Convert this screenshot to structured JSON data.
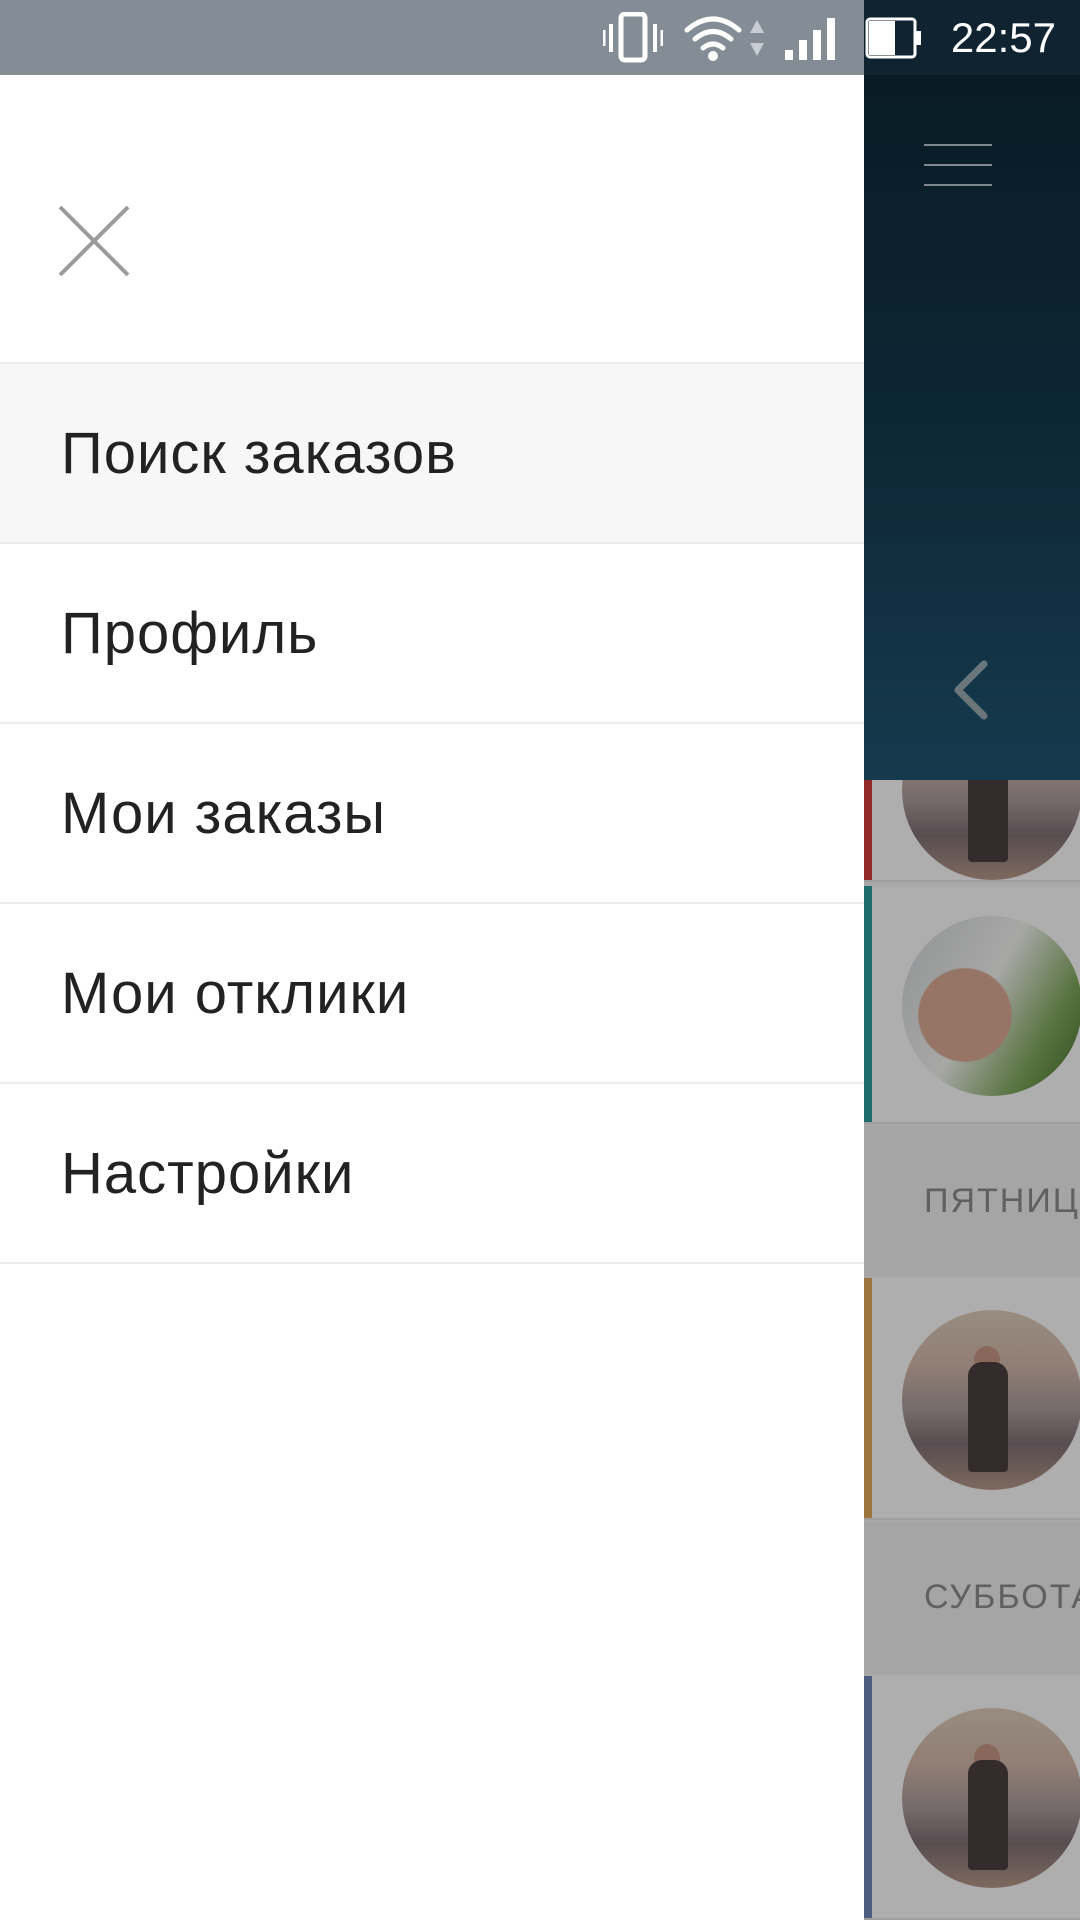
{
  "status_bar": {
    "time": "22:57",
    "icons": [
      "vibrate-icon",
      "wifi-icon",
      "data-arrows-icon",
      "signal-icon",
      "battery-icon"
    ]
  },
  "drawer": {
    "close_icon": "close-icon",
    "items": [
      {
        "label": "Поиск заказов",
        "active": true
      },
      {
        "label": "Профиль",
        "active": false
      },
      {
        "label": "Мои заказы",
        "active": false
      },
      {
        "label": "Мои отклики",
        "active": false
      },
      {
        "label": "Настройки",
        "active": false
      }
    ]
  },
  "background": {
    "header_icons": [
      "menu-icon",
      "back-chevron-icon"
    ],
    "sections": [
      {
        "label": "ПЯТНИЦА"
      },
      {
        "label": "СУББОТА"
      }
    ],
    "card_strip_colors": [
      "#d23b3b",
      "#2a9a9a",
      "#e0a65a",
      "#6f86b8"
    ]
  },
  "colors": {
    "status_bar_left": "#848d96",
    "status_bar_right": "#0f2330",
    "drawer_background": "#ffffff",
    "active_item_background": "#f7f7f7"
  }
}
